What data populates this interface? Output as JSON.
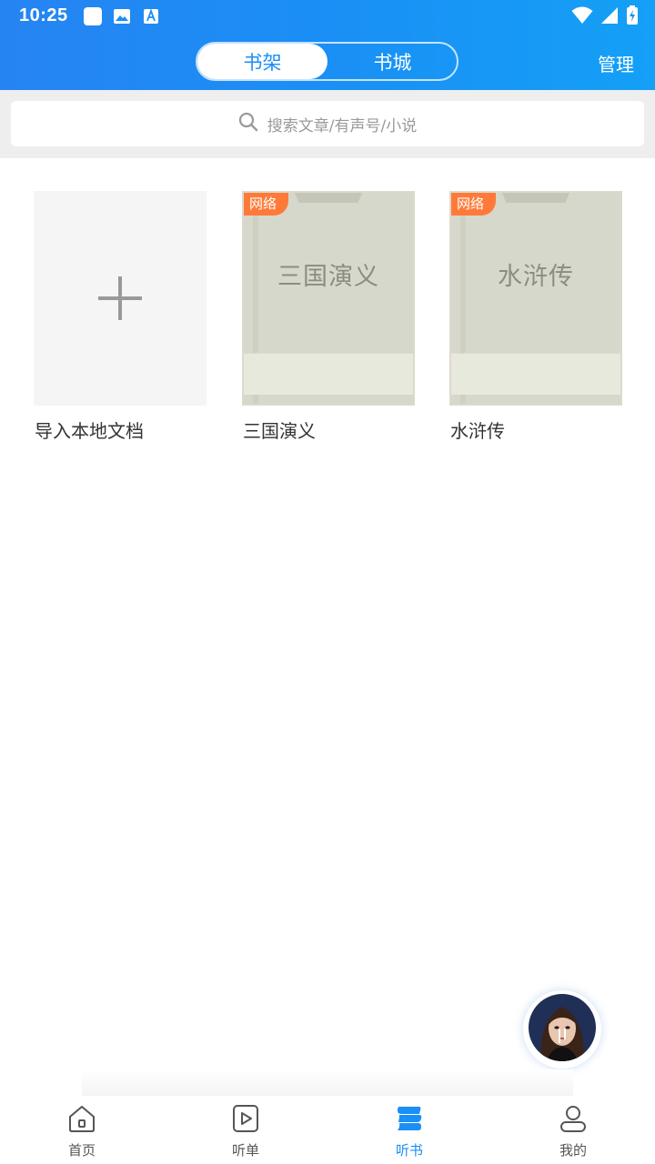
{
  "status_bar": {
    "time": "10:25",
    "left_icons": [
      "app-square-icon",
      "image-icon",
      "font-a-icon"
    ],
    "right_icons": [
      "wifi-icon",
      "signal-icon",
      "battery-icon"
    ]
  },
  "header": {
    "tabs": [
      {
        "label": "书架",
        "active": true
      },
      {
        "label": "书城",
        "active": false
      }
    ],
    "manage_label": "管理",
    "gradient_start": "#2684f2",
    "gradient_end": "#14a0f6"
  },
  "search": {
    "placeholder": "搜索文章/有声号/小说",
    "icon": "search-icon"
  },
  "shelf": {
    "import": {
      "label": "导入本地文档",
      "icon": "plus-icon"
    },
    "books": [
      {
        "title": "三国演义",
        "cover_title": "三国演义",
        "badge": "网络"
      },
      {
        "title": "水浒传",
        "cover_title": "水浒传",
        "badge": "网络"
      }
    ]
  },
  "floating_player": {
    "icon": "avatar-icon"
  },
  "bottom_nav": {
    "items": [
      {
        "label": "首页",
        "icon": "home-icon",
        "active": false
      },
      {
        "label": "听单",
        "icon": "play-list-icon",
        "active": false
      },
      {
        "label": "听书",
        "icon": "listen-book-icon",
        "active": true
      },
      {
        "label": "我的",
        "icon": "user-icon",
        "active": false
      }
    ]
  },
  "colors": {
    "accent": "#1a8ff5",
    "badge": "#ff7a38",
    "cover": "#d6d8cb"
  }
}
